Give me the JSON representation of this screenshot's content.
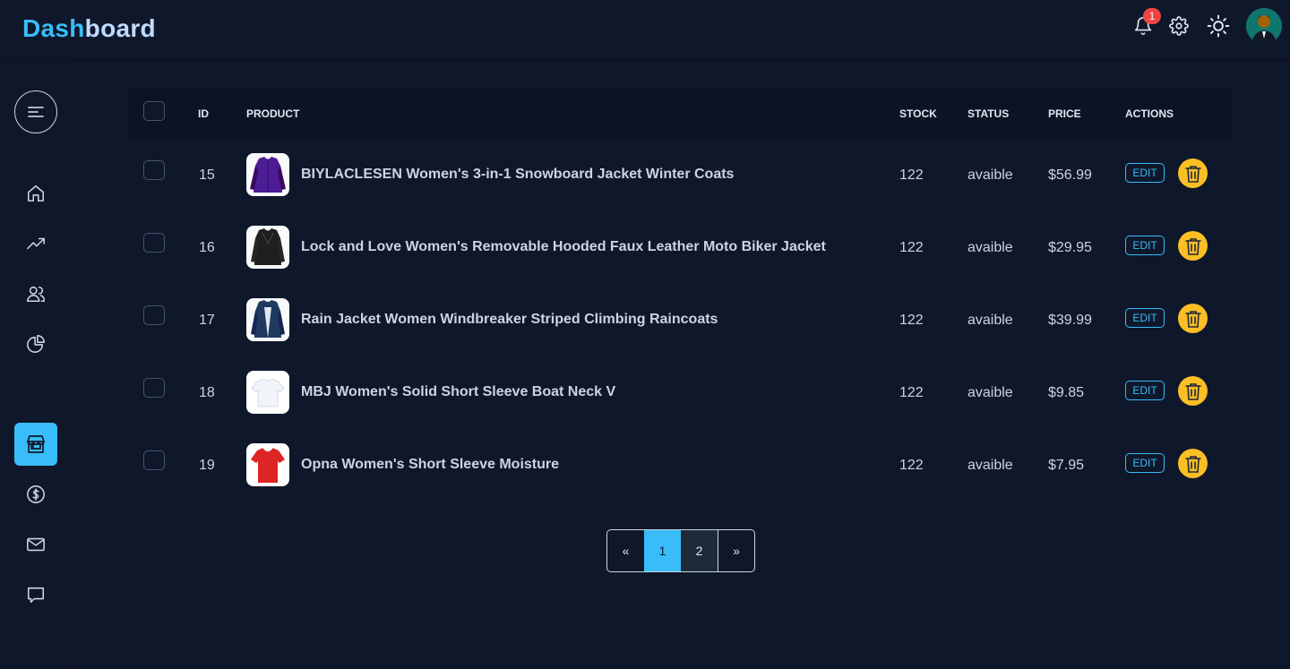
{
  "app": {
    "brand_part1": "Dash",
    "brand_part2": "board"
  },
  "header": {
    "notification_count": "1",
    "icons": [
      "bell-icon",
      "gear-icon",
      "sun-icon"
    ],
    "avatar": "user-avatar"
  },
  "sidebar": {
    "items": [
      {
        "icon": "home-icon",
        "active": false
      },
      {
        "icon": "trending-up-icon",
        "active": false
      },
      {
        "icon": "users-icon",
        "active": false
      },
      {
        "icon": "pie-chart-icon",
        "active": false
      },
      {
        "icon": "store-icon",
        "active": true
      },
      {
        "icon": "dollar-icon",
        "active": false
      },
      {
        "icon": "mail-icon",
        "active": false
      },
      {
        "icon": "chat-icon",
        "active": false
      }
    ]
  },
  "table": {
    "headers": {
      "id": "ID",
      "product": "PRODUCT",
      "stock": "STOCK",
      "status": "STATUS",
      "price": "PRICE",
      "actions": "ACTIONS"
    },
    "rows": [
      {
        "id": "15",
        "product": "BIYLACLESEN Women's 3-in-1 Snowboard Jacket Winter Coats",
        "stock": "122",
        "status": "avaible",
        "price": "$56.99",
        "edit": "EDIT",
        "thumb_color": "#4c1d95"
      },
      {
        "id": "16",
        "product": "Lock and Love Women's Removable Hooded Faux Leather Moto Biker Jacket",
        "stock": "122",
        "status": "avaible",
        "price": "$29.95",
        "edit": "EDIT",
        "thumb_color": "#1f1f1f"
      },
      {
        "id": "17",
        "product": "Rain Jacket Women Windbreaker Striped Climbing Raincoats",
        "stock": "122",
        "status": "avaible",
        "price": "$39.99",
        "edit": "EDIT",
        "thumb_color": "#1e3a5f"
      },
      {
        "id": "18",
        "product": "MBJ Women's Solid Short Sleeve Boat Neck V",
        "stock": "122",
        "status": "avaible",
        "price": "$9.85",
        "edit": "EDIT",
        "thumb_color": "#f1f5f9"
      },
      {
        "id": "19",
        "product": "Opna Women's Short Sleeve Moisture",
        "stock": "122",
        "status": "avaible",
        "price": "$7.95",
        "edit": "EDIT",
        "thumb_color": "#dc2626"
      }
    ]
  },
  "pagination": {
    "prev": "«",
    "pages": [
      "1",
      "2"
    ],
    "current": "1",
    "next": "»"
  },
  "colors": {
    "accent": "#38bdf8",
    "background": "#0f172a",
    "delete": "#fbbf24",
    "badge": "#ef4444"
  }
}
